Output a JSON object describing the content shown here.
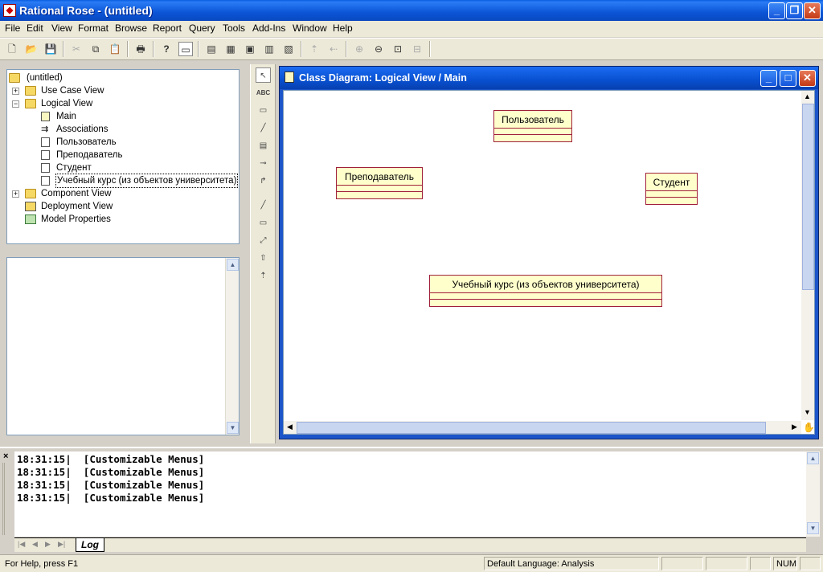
{
  "window": {
    "title": "Rational Rose - (untitled)"
  },
  "menu": [
    {
      "label": "File"
    },
    {
      "label": "Edit"
    },
    {
      "label": "View"
    },
    {
      "label": "Format"
    },
    {
      "label": "Browse"
    },
    {
      "label": "Report"
    },
    {
      "label": "Query"
    },
    {
      "label": "Tools"
    },
    {
      "label": "Add-Ins"
    },
    {
      "label": "Window"
    },
    {
      "label": "Help"
    }
  ],
  "browser": {
    "root": "(untitled)",
    "items": [
      {
        "label": "Use Case View"
      },
      {
        "label": "Logical View"
      },
      {
        "label": "Main"
      },
      {
        "label": "Associations"
      },
      {
        "label": "Пользователь"
      },
      {
        "label": "Преподаватель"
      },
      {
        "label": "Студент"
      },
      {
        "label": "Учебный курс (из объектов университета)"
      },
      {
        "label": "Component View"
      },
      {
        "label": "Deployment View"
      },
      {
        "label": "Model Properties"
      }
    ]
  },
  "toolbox": {
    "text_tool": "ABC"
  },
  "diagram": {
    "title": "Class Diagram: Logical View / Main",
    "classes": [
      {
        "name": "Пользователь"
      },
      {
        "name": "Преподаватель"
      },
      {
        "name": "Студент"
      },
      {
        "name": "Учебный курс (из объектов университета)"
      }
    ]
  },
  "log": {
    "lines": [
      {
        "time": "18:31:15|",
        "message": "[Customizable Menus]"
      },
      {
        "time": "18:31:15|",
        "message": "[Customizable Menus]"
      },
      {
        "time": "18:31:15|",
        "message": "[Customizable Menus]"
      },
      {
        "time": "18:31:15|",
        "message": "[Customizable Menus]"
      }
    ],
    "tab": "Log"
  },
  "status": {
    "help": "For Help, press F1",
    "language": "Default Language: Analysis",
    "num": "NUM"
  }
}
